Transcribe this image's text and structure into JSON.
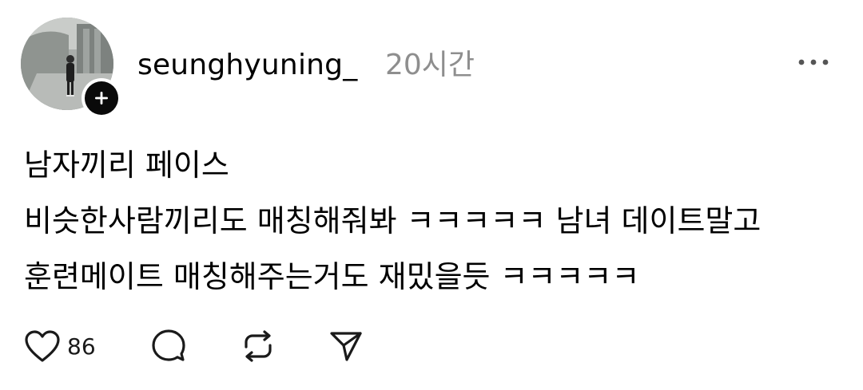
{
  "post": {
    "username": "seunghyuning_",
    "timestamp": "20시간",
    "text_lines": [
      "남자끼리 페이스",
      "비슷한사람끼리도 매칭해줘봐 ㅋㅋㅋㅋㅋ 남녀 데이트말고",
      "훈련메이트 매칭해주는거도 재밌을듯 ㅋㅋㅋㅋㅋ"
    ],
    "like_count": "86"
  },
  "icons": {
    "follow": "plus-icon",
    "more": "more-horizontal-icon",
    "like": "heart-icon",
    "comment": "comment-icon",
    "repost": "repost-icon",
    "share": "send-icon"
  },
  "colors": {
    "text": "#000000",
    "muted": "#8e8e8e",
    "background": "#ffffff"
  }
}
